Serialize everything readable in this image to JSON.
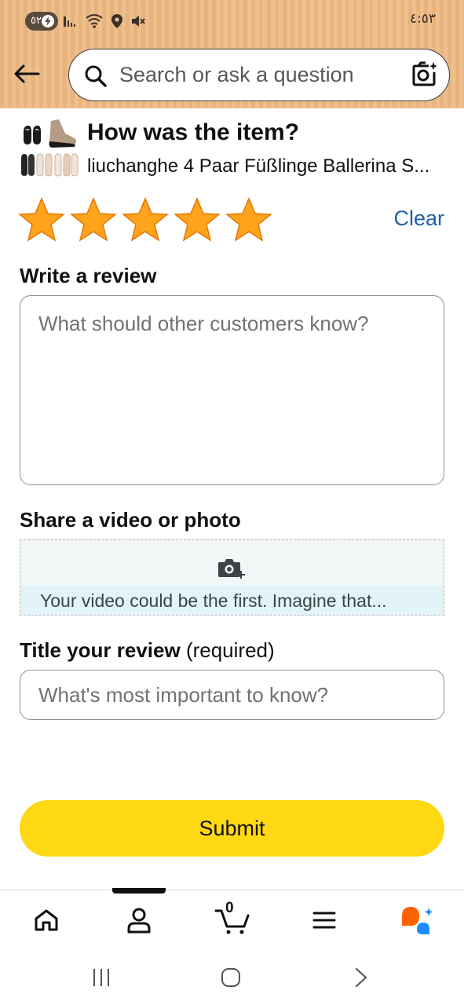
{
  "status_bar": {
    "battery_level": "٥٢",
    "time": "٤:٥٣"
  },
  "search": {
    "placeholder": "Search or ask a question"
  },
  "product": {
    "question": "How was the item?",
    "name": "liuchanghe 4 Paar Füßlinge Ballerina S..."
  },
  "rating": {
    "stars_selected": 5,
    "stars_total": 5,
    "clear_label": "Clear"
  },
  "review": {
    "heading": "Write a review",
    "placeholder": "What should other customers know?"
  },
  "media": {
    "heading": "Share a video or photo",
    "prompt": "Your video could be the first. Imagine that..."
  },
  "title": {
    "heading": "Title your review",
    "heading_suffix": " (required)",
    "placeholder": "What's most important to know?"
  },
  "submit_label": "Submit",
  "bottom_nav": {
    "items": [
      "home-icon",
      "account-icon",
      "cart-icon",
      "menu-icon",
      "rufus-icon"
    ],
    "cart_count": "0",
    "active": "account-icon"
  },
  "colors": {
    "header_bg": "#eebf8c",
    "star": "#ffa41c",
    "link": "#2162a1",
    "submit_bg": "#ffd814",
    "rufus_orange": "#ff6200",
    "rufus_blue": "#1a8cff"
  }
}
